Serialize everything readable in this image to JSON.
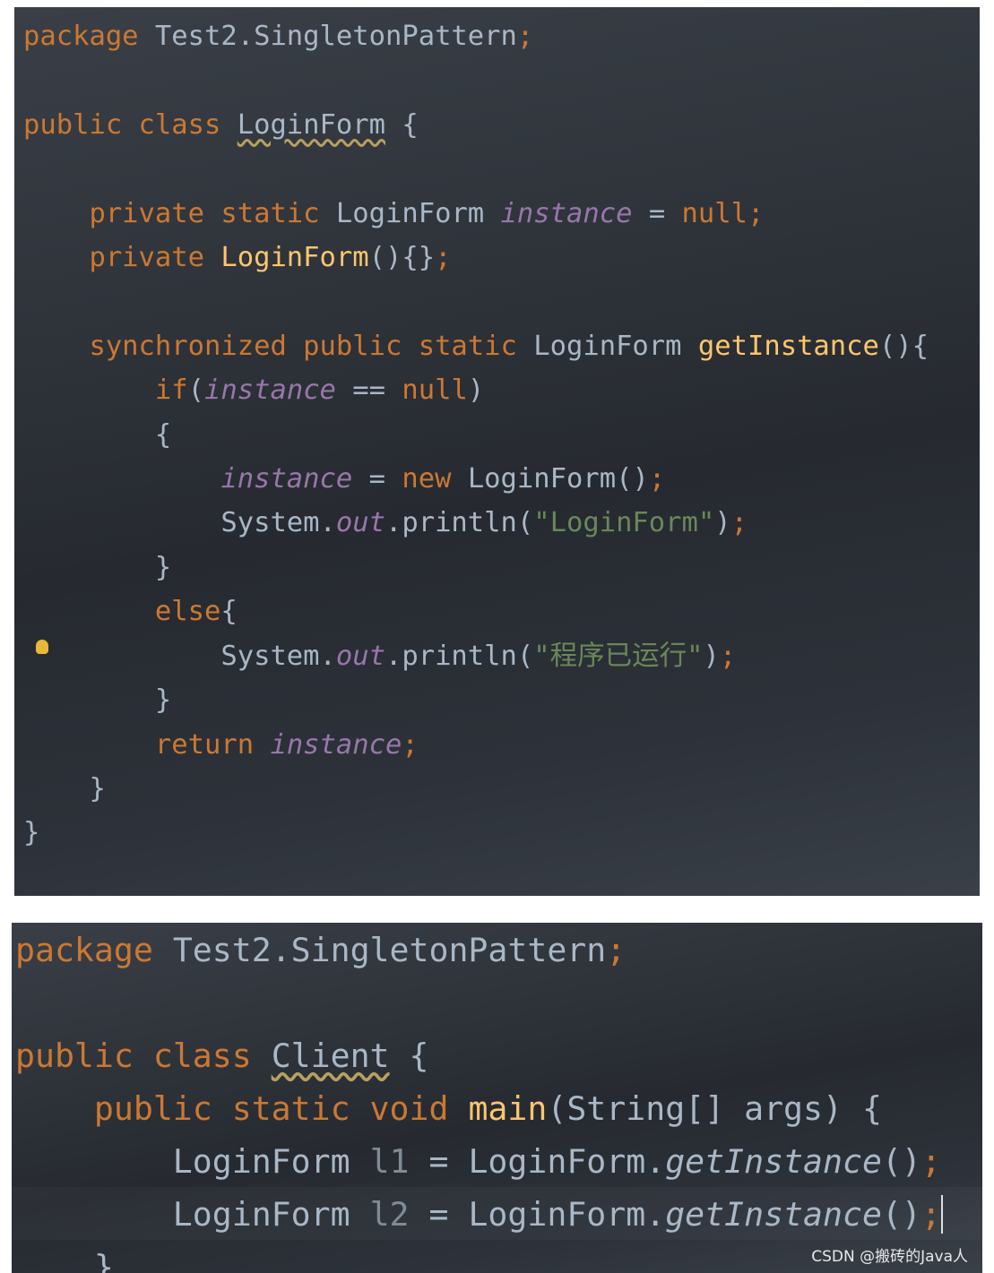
{
  "colors": {
    "keyword": "#cc7832",
    "text": "#a9b7c6",
    "field": "#9876aa",
    "string": "#6a8759",
    "method": "#ffc66d",
    "background": "#2b2f36"
  },
  "panel1": {
    "lines": [
      [
        [
          "kw",
          "package "
        ],
        [
          "",
          "Test2.SingletonPattern"
        ],
        [
          "kw",
          ";"
        ]
      ],
      [],
      [
        [
          "kw",
          "public class "
        ],
        [
          "sq",
          "LoginForm"
        ],
        [
          "",
          " {"
        ]
      ],
      [],
      [
        [
          "",
          "    "
        ],
        [
          "kw",
          "private static "
        ],
        [
          "",
          "LoginForm "
        ],
        [
          "fld",
          "instance"
        ],
        [
          "",
          " = "
        ],
        [
          "kw",
          "null;"
        ]
      ],
      [
        [
          "",
          "    "
        ],
        [
          "kw",
          "private "
        ],
        [
          "mth",
          "LoginForm"
        ],
        [
          "",
          "(){}"
        ],
        [
          "kw",
          ";"
        ]
      ],
      [],
      [
        [
          "",
          "    "
        ],
        [
          "kw",
          "synchronized public static "
        ],
        [
          "",
          "LoginForm "
        ],
        [
          "mth",
          "getInstance"
        ],
        [
          "",
          "(){"
        ]
      ],
      [
        [
          "",
          "        "
        ],
        [
          "kw",
          "if"
        ],
        [
          "",
          "("
        ],
        [
          "fld",
          "instance"
        ],
        [
          "",
          " == "
        ],
        [
          "kw",
          "null"
        ],
        [
          "",
          ")"
        ]
      ],
      [
        [
          "",
          "        {"
        ]
      ],
      [
        [
          "",
          "            "
        ],
        [
          "fld",
          "instance"
        ],
        [
          "",
          " = "
        ],
        [
          "kw",
          "new "
        ],
        [
          "",
          "LoginForm()"
        ],
        [
          "kw",
          ";"
        ]
      ],
      [
        [
          "",
          "            System."
        ],
        [
          "fld",
          "out"
        ],
        [
          "",
          ".println("
        ],
        [
          "str",
          "\"LoginForm\""
        ],
        [
          "",
          ")"
        ],
        [
          "kw",
          ";"
        ]
      ],
      [
        [
          "",
          "        }"
        ]
      ],
      [
        [
          "",
          "        "
        ],
        [
          "kw",
          "else"
        ],
        [
          "",
          "{"
        ]
      ],
      [
        [
          "",
          "            System."
        ],
        [
          "fld",
          "out"
        ],
        [
          "",
          ".println("
        ],
        [
          "str",
          "\"程序已运行\""
        ],
        [
          "",
          ")"
        ],
        [
          "kw",
          ";"
        ]
      ],
      [
        [
          "",
          "        }"
        ]
      ],
      [
        [
          "",
          "        "
        ],
        [
          "kw",
          "return "
        ],
        [
          "fld",
          "instance"
        ],
        [
          "kw",
          ";"
        ]
      ],
      [
        [
          "",
          "    }"
        ]
      ],
      [
        [
          "",
          "}"
        ]
      ]
    ]
  },
  "panel2": {
    "lines": [
      [
        [
          "kw",
          "package "
        ],
        [
          "",
          "Test2.SingletonPattern"
        ],
        [
          "kw",
          ";"
        ]
      ],
      [],
      [
        [
          "kw",
          "public class "
        ],
        [
          "sq",
          "Client"
        ],
        [
          "",
          " {"
        ]
      ],
      [
        [
          "",
          "    "
        ],
        [
          "kw",
          "public static void "
        ],
        [
          "mth",
          "main"
        ],
        [
          "",
          "(String[] args) {"
        ]
      ],
      [
        [
          "",
          "        LoginForm "
        ],
        [
          "var",
          "l1"
        ],
        [
          "",
          " = LoginForm."
        ],
        [
          "st",
          "getInstance"
        ],
        [
          "",
          "()"
        ],
        [
          "kw",
          ";"
        ]
      ],
      [
        [
          "",
          "        LoginForm "
        ],
        [
          "var",
          "l2"
        ],
        [
          "",
          " = LoginForm."
        ],
        [
          "st",
          "getInstance"
        ],
        [
          "",
          "()"
        ],
        [
          "kw cur",
          ";"
        ]
      ],
      [
        [
          "",
          "    }"
        ]
      ]
    ]
  },
  "watermark": "CSDN @搬砖的Java人",
  "icons": {
    "intention": "lightbulb-icon"
  }
}
